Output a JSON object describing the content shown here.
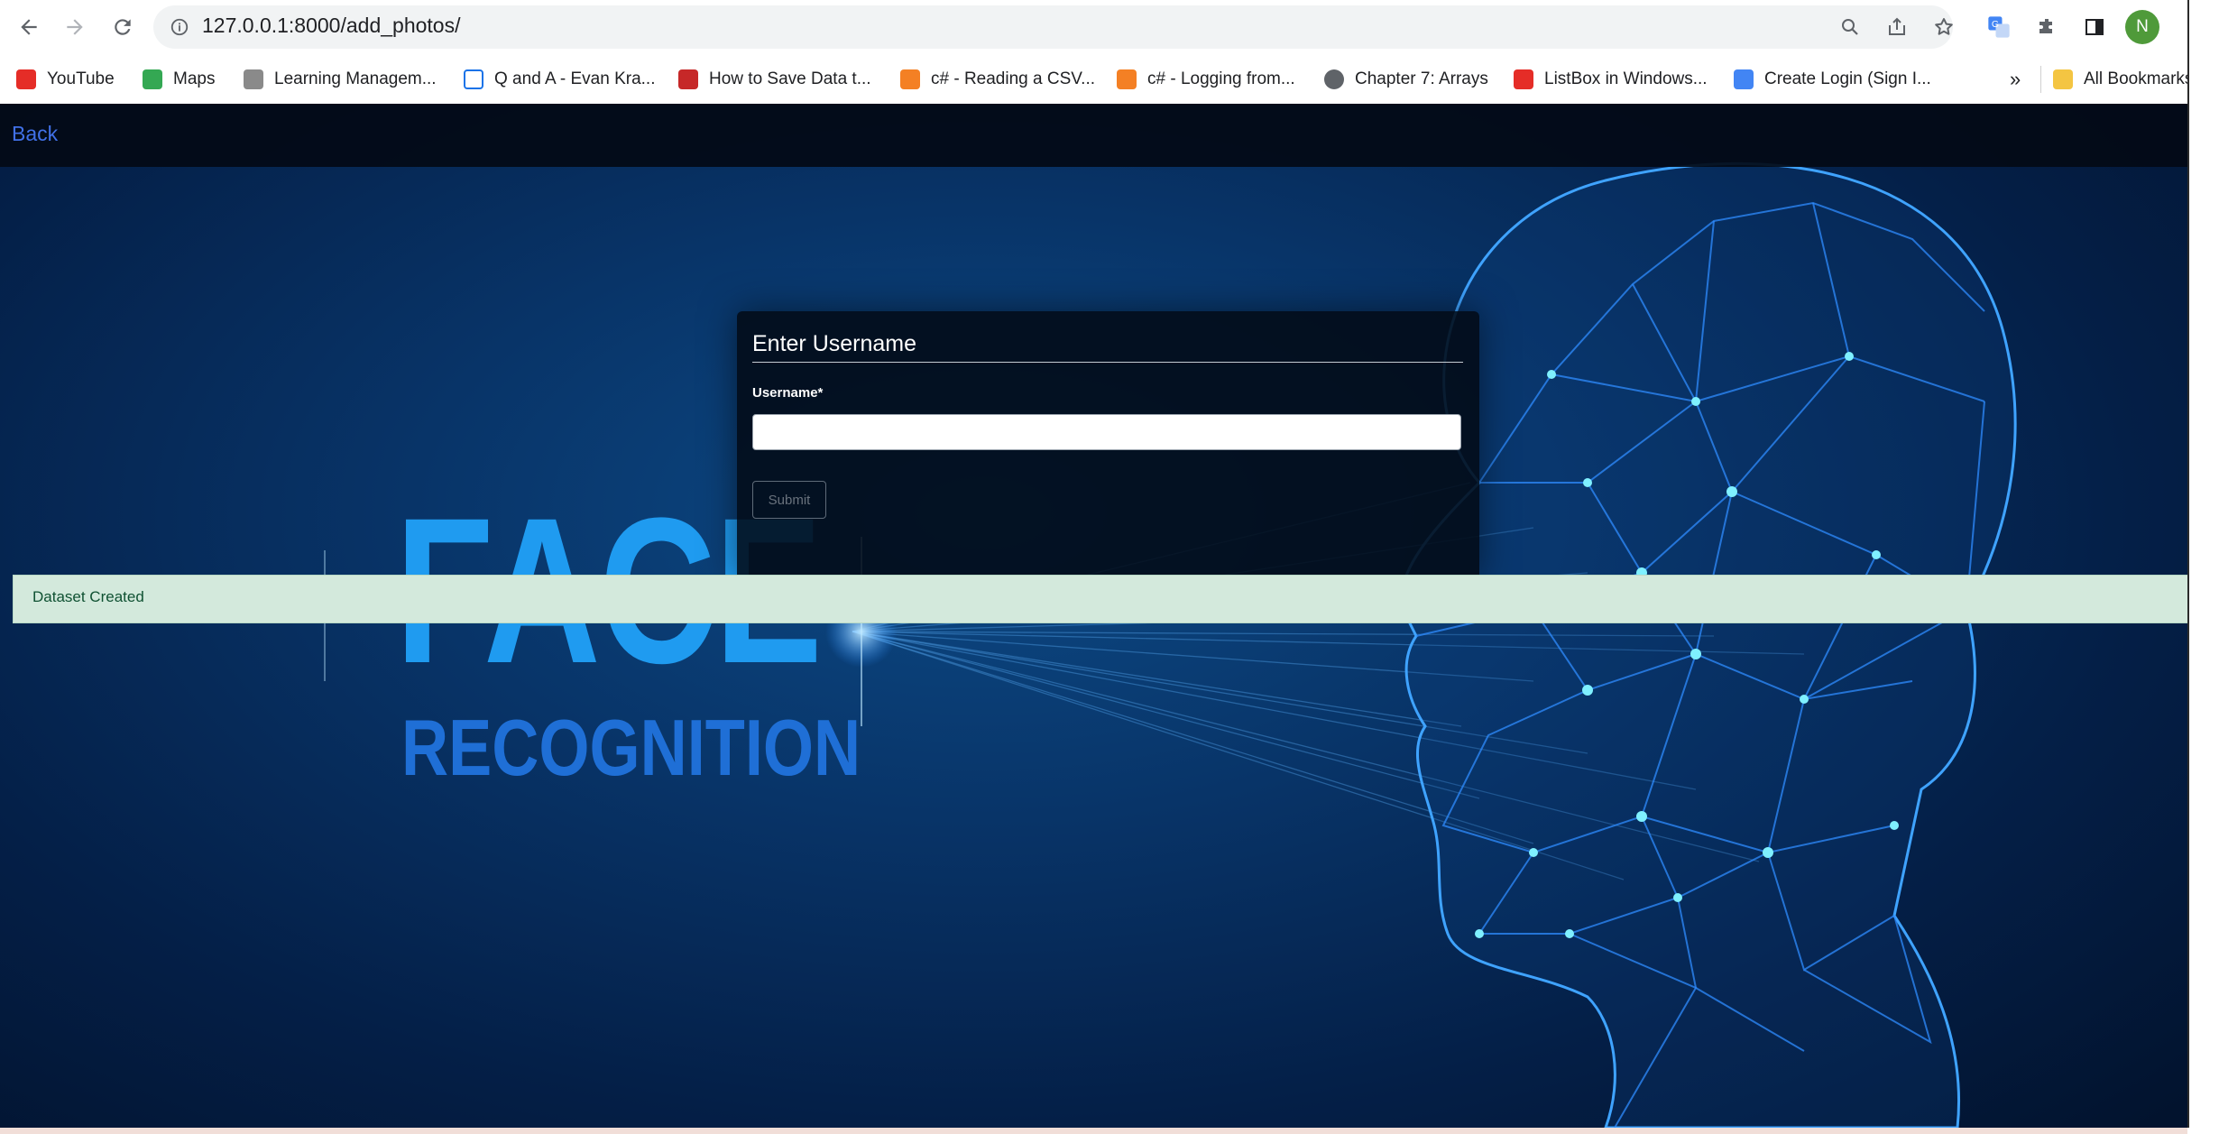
{
  "browser": {
    "url": "127.0.0.1:8000/add_photos/",
    "profile_initial": "N",
    "bookmarks": [
      {
        "label": "YouTube",
        "color": "#e52d27"
      },
      {
        "label": "Maps",
        "color": "#34a853"
      },
      {
        "label": "Learning Managem...",
        "color": "#6b6b6b"
      },
      {
        "label": "Q and A - Evan Kra...",
        "color": "#1a73e8"
      },
      {
        "label": "How to Save Data t...",
        "color": "#c62828"
      },
      {
        "label": "c# - Reading a CSV...",
        "color": "#f48024"
      },
      {
        "label": "c# - Logging from...",
        "color": "#f48024"
      },
      {
        "label": "Chapter 7: Arrays",
        "color": "#5f6368"
      },
      {
        "label": "ListBox in Windows...",
        "color": "#e52d27"
      },
      {
        "label": "Create Login (Sign I...",
        "color": "#4285f4"
      }
    ],
    "overflow_label": "»",
    "all_bookmarks_label": "All Bookmarks"
  },
  "page": {
    "back_label": "Back",
    "hero_line1": "FACE",
    "hero_line2": "RECOGNITION",
    "form": {
      "title": "Enter Username",
      "username_label": "Username*",
      "username_value": "",
      "submit_label": "Submit"
    },
    "alert_message": "Dataset Created"
  },
  "colors": {
    "accent_blue": "#1f9bf0",
    "link_blue": "#4171e8",
    "success_bg": "#d3e9dc",
    "success_text": "#0f5132"
  }
}
